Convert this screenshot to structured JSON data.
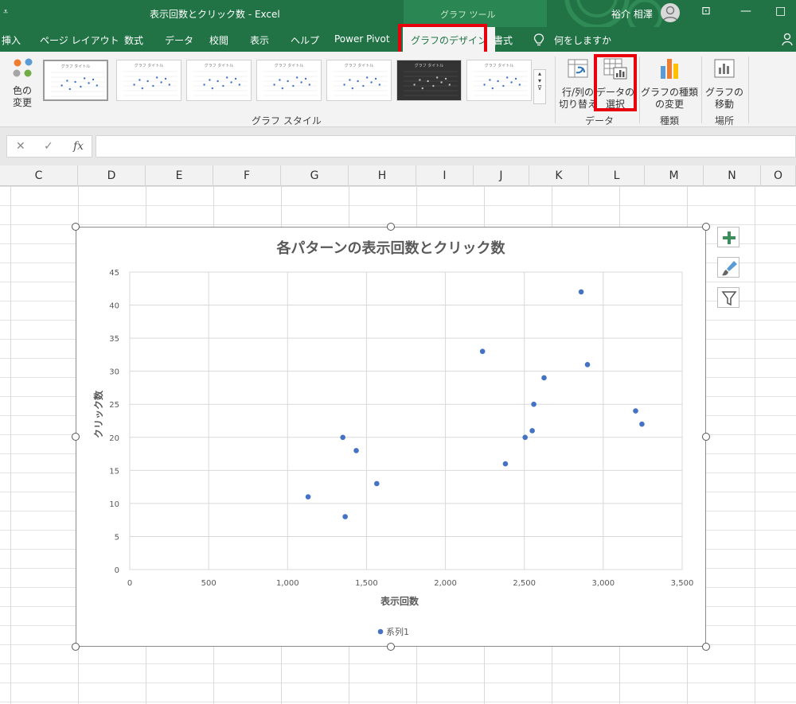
{
  "titlebar": {
    "quick_access": "⩡",
    "doc_title": "表示回数とクリック数  -  Excel",
    "tool_context": "グラフ ツール",
    "user": "裕介 相澤",
    "min": "—",
    "restore": "□",
    "ribbon_display": "⊡"
  },
  "tabs": [
    {
      "label": "挿入"
    },
    {
      "label": "ページ レイアウト"
    },
    {
      "label": "数式"
    },
    {
      "label": "データ"
    },
    {
      "label": "校閲"
    },
    {
      "label": "表示"
    },
    {
      "label": "ヘルプ"
    },
    {
      "label": "Power Pivot"
    },
    {
      "label": "グラフのデザイン"
    },
    {
      "label": "書式"
    },
    {
      "label": "何をしますか"
    }
  ],
  "ribbon": {
    "change_color": "色の\n変更",
    "change_color_line1": "色の",
    "change_color_line2": "変更",
    "styles_group": "グラフ スタイル",
    "thumb_title": "グラフ タイトル",
    "switch_rowcol_line1": "行/列の",
    "switch_rowcol_line2": "切り替え",
    "select_data_line1": "データの",
    "select_data_line2": "選択",
    "data_group": "データ",
    "change_type_line1": "グラフの種類",
    "change_type_line2": "の変更",
    "type_group": "種類",
    "move_line1": "グラフの",
    "move_line2": "移動",
    "location_group": "場所"
  },
  "formula_bar": {
    "cancel": "✕",
    "enter": "✓",
    "fx": "fx",
    "value": ""
  },
  "columns": [
    "C",
    "D",
    "E",
    "F",
    "G",
    "H",
    "I",
    "J",
    "K",
    "L",
    "M",
    "N",
    "O"
  ],
  "chart_data": {
    "type": "scatter",
    "title": "各パターンの表示回数とクリック数",
    "xlabel": "表示回数",
    "ylabel": "クリック数",
    "xlim": [
      0,
      3500
    ],
    "ylim": [
      0,
      45
    ],
    "x_ticks": [
      "0",
      "500",
      "1,000",
      "1,500",
      "2,000",
      "2,500",
      "3,000",
      "3,500"
    ],
    "y_ticks": [
      "0",
      "5",
      "10",
      "15",
      "20",
      "25",
      "30",
      "35",
      "40",
      "45"
    ],
    "grid": true,
    "legend_position": "bottom",
    "color": "#4472c4",
    "series": [
      {
        "name": "系列1",
        "points": [
          [
            1130,
            11
          ],
          [
            1350,
            20
          ],
          [
            1365,
            8
          ],
          [
            1435,
            18
          ],
          [
            1565,
            13
          ],
          [
            2235,
            33
          ],
          [
            2380,
            16
          ],
          [
            2505,
            20
          ],
          [
            2550,
            21
          ],
          [
            2560,
            25
          ],
          [
            2625,
            29
          ],
          [
            2860,
            42
          ],
          [
            2900,
            31
          ],
          [
            3205,
            24
          ],
          [
            3245,
            22
          ]
        ]
      }
    ]
  },
  "side_buttons": [
    {
      "icon": "plus-icon",
      "glyph": "✚"
    },
    {
      "icon": "brush-icon",
      "glyph": "🖌"
    },
    {
      "icon": "filter-icon",
      "glyph": "▼"
    }
  ]
}
